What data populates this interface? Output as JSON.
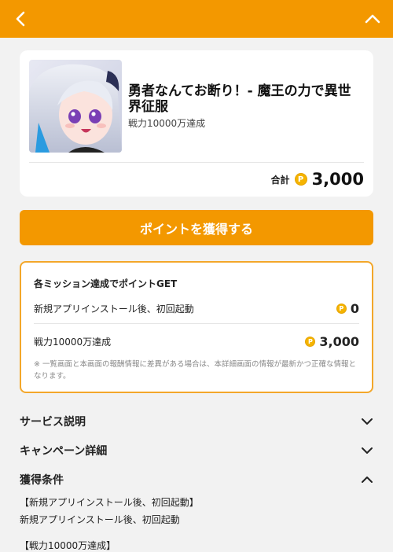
{
  "header": {
    "back_icon": "chevron-left-icon",
    "collapse_icon": "chevron-up-icon",
    "bar_color": "#f39800"
  },
  "offer": {
    "title": "勇者なんてお断り！- 魔王の力で異世界征服",
    "subtitle": "戦力10000万達成",
    "total_label": "合計",
    "total_points": "3,000",
    "coin_symbol": "P"
  },
  "cta": {
    "label": "ポイントを獲得する"
  },
  "missions": {
    "heading": "各ミッション達成でポイントGET",
    "items": [
      {
        "label": "新規アプリインストール後、初回起動",
        "points": "0"
      },
      {
        "label": "戦力10000万達成",
        "points": "3,000"
      }
    ],
    "notice": "※ 一覧画面と本画面の報酬情報に差異がある場合は、本詳細画面の情報が最新かつ正確な情報となります。"
  },
  "sections": [
    {
      "title": "サービス説明",
      "state": "collapsed"
    },
    {
      "title": "キャンペーン詳細",
      "state": "collapsed"
    },
    {
      "title": "獲得条件",
      "state": "expanded"
    }
  ],
  "conditions": {
    "line1": "【新規アプリインストール後、初回起動】",
    "line2": "新規アプリインストール後、初回起動",
    "line3": "【戦力10000万達成】"
  }
}
